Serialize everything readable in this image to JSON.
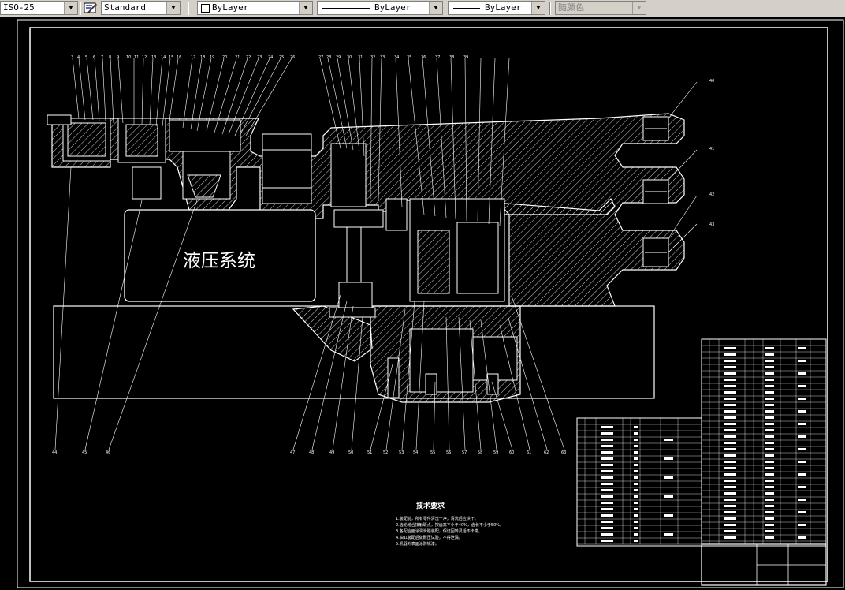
{
  "toolbar": {
    "dimstyle": {
      "value": "ISO-25"
    },
    "textstyle": {
      "value": "Standard"
    },
    "layer": {
      "value": "ByLayer"
    },
    "linetype": {
      "value": "ByLayer"
    },
    "lineweight": {
      "value": "ByLayer"
    },
    "color": {
      "value": "随颜色"
    }
  },
  "drawing": {
    "hydraulic_label": "液压系统",
    "top_callouts": [
      "3",
      "4",
      "5",
      "6",
      "7",
      "8",
      "9",
      "10",
      "11",
      "12",
      "13",
      "14",
      "15",
      "16",
      "17",
      "18",
      "19",
      "20",
      "21",
      "22",
      "23",
      "24",
      "25",
      "26",
      "27",
      "28",
      "29",
      "30",
      "31",
      "32",
      "33",
      "34",
      "35",
      "36",
      "37",
      "38",
      "39"
    ],
    "right_callouts": [
      "40",
      "41",
      "42",
      "43"
    ],
    "bottom_callouts": [
      "44",
      "45",
      "46",
      "47",
      "48",
      "49",
      "50",
      "51",
      "52",
      "53",
      "54",
      "55",
      "56",
      "57",
      "58",
      "59",
      "60",
      "61",
      "62",
      "63",
      "64",
      "65"
    ],
    "tech_requirements": {
      "title": "技术要求",
      "lines": [
        "1.装配前，所有零件清洗干净，清洗后应烘干。",
        "2.齿轮啮合接触斑点，按齿高不小于40%，齿长不小于50%。",
        "3.各配合面涂润滑脂装配，保证回转灵活不卡滞。",
        "4.油缸装配后做耐压试验，不得泄漏。",
        "5.机器外表面涂防锈漆。"
      ]
    }
  },
  "colors": {
    "background": "#000000",
    "lines": "#ffffff",
    "toolbar": "#d4d0c8"
  }
}
